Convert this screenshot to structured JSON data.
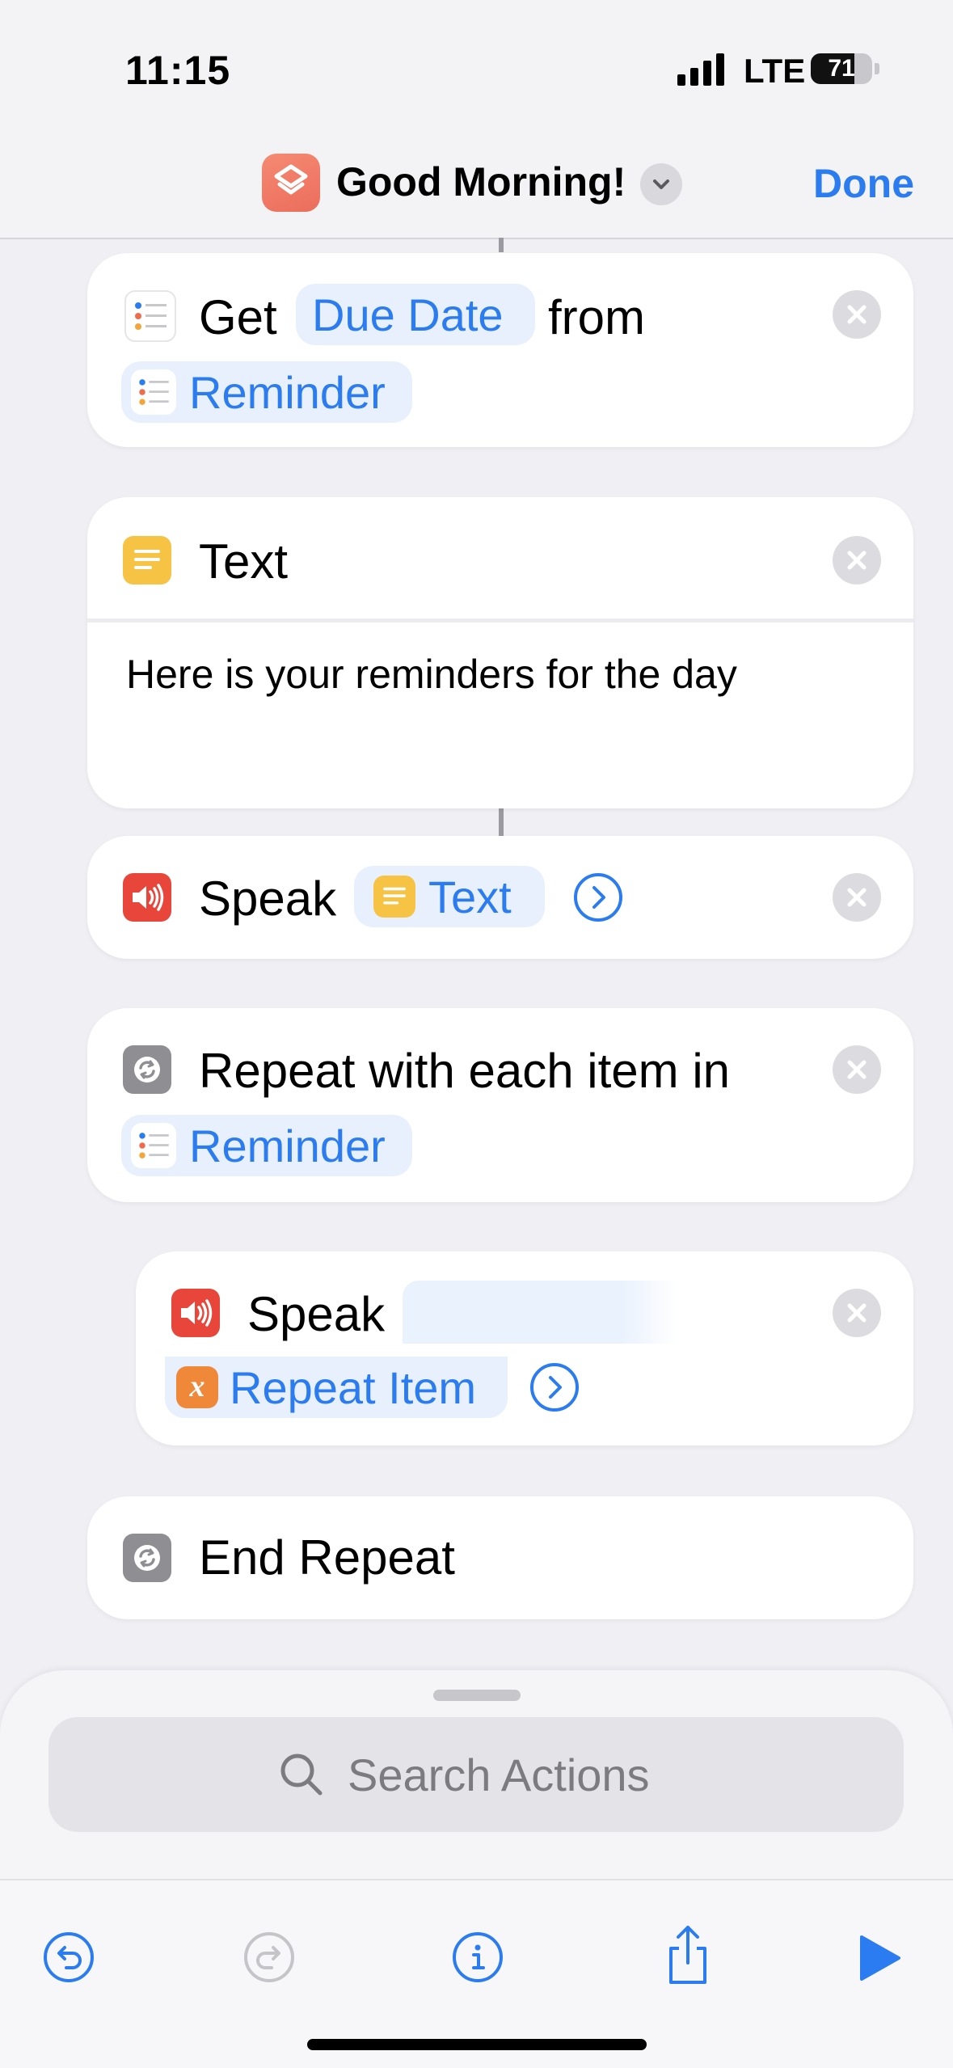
{
  "status_bar": {
    "time": "11:15",
    "network": "LTE",
    "battery": "71",
    "battery_level": 0.71
  },
  "header": {
    "title": "Good Morning!",
    "done_label": "Done"
  },
  "actions": {
    "get": {
      "verb": "Get",
      "property": "Due Date",
      "from": "from",
      "source": "Reminder"
    },
    "text": {
      "title": "Text",
      "body": "Here is your reminders for the day"
    },
    "speak1": {
      "verb": "Speak",
      "input": "Text"
    },
    "repeat": {
      "title": "Repeat with each item in",
      "source": "Reminder"
    },
    "speak2": {
      "verb": "Speak",
      "input": "Repeat Item",
      "var_glyph": "x"
    },
    "end_repeat": {
      "title": "End Repeat"
    }
  },
  "search": {
    "placeholder": "Search Actions"
  },
  "toolbar": {
    "items": [
      "undo-icon",
      "redo-icon",
      "info-icon",
      "share-icon",
      "play-icon"
    ]
  },
  "colors": {
    "accent": "#2b7cf0",
    "token_bg": "#e7f0fc",
    "speak_red": "#e8463a",
    "text_yellow": "#f6c344",
    "repeat_gray": "#8e8e93",
    "variable_orange": "#f0883a"
  }
}
